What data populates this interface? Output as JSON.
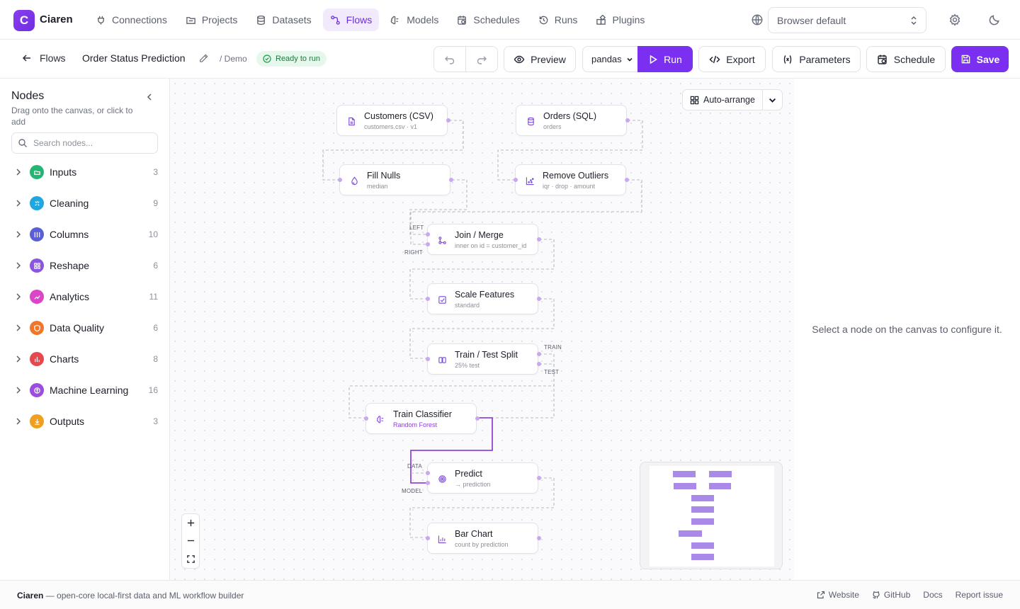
{
  "app": {
    "logo_letter": "C",
    "name": "Ciaren"
  },
  "nav": [
    {
      "label": "Connections",
      "icon": "plug-icon"
    },
    {
      "label": "Projects",
      "icon": "folder-icon"
    },
    {
      "label": "Datasets",
      "icon": "database-icon"
    },
    {
      "label": "Flows",
      "icon": "flow-icon",
      "active": true
    },
    {
      "label": "Models",
      "icon": "brain-icon"
    },
    {
      "label": "Schedules",
      "icon": "calendar-clock-icon"
    },
    {
      "label": "Runs",
      "icon": "history-icon"
    },
    {
      "label": "Plugins",
      "icon": "puzzle-icon"
    }
  ],
  "language_select": {
    "value": "Browser default"
  },
  "toolbar": {
    "back_label": "Flows",
    "flow_title": "Order Status Prediction",
    "breadcrumb": "/ Demo",
    "status": "Ready to run",
    "preview_label": "Preview",
    "engine": "pandas",
    "run_label": "Run",
    "export_label": "Export",
    "parameters_label": "Parameters",
    "schedule_label": "Schedule",
    "save_label": "Save"
  },
  "sidebar": {
    "title": "Nodes",
    "subtitle": "Drag onto the canvas, or click to add",
    "search_placeholder": "Search nodes...",
    "categories": [
      {
        "label": "Inputs",
        "count": "3",
        "color": "#22b573"
      },
      {
        "label": "Cleaning",
        "count": "9",
        "color": "#1ea7e1"
      },
      {
        "label": "Columns",
        "count": "10",
        "color": "#5b5fd6"
      },
      {
        "label": "Reshape",
        "count": "6",
        "color": "#8a55e0"
      },
      {
        "label": "Analytics",
        "count": "11",
        "color": "#d946c8"
      },
      {
        "label": "Data Quality",
        "count": "6",
        "color": "#f0762b"
      },
      {
        "label": "Charts",
        "count": "8",
        "color": "#e5484d"
      },
      {
        "label": "Machine Learning",
        "count": "16",
        "color": "#9b4de0"
      },
      {
        "label": "Outputs",
        "count": "3",
        "color": "#f0a020"
      }
    ]
  },
  "canvas": {
    "auto_arrange_label": "Auto-arrange",
    "nodes": [
      {
        "title": "Customers (CSV)",
        "sub": "customers.csv · v1",
        "icon": "file-icon"
      },
      {
        "title": "Orders (SQL)",
        "sub": "orders",
        "icon": "database-icon"
      },
      {
        "title": "Fill Nulls",
        "sub": "median",
        "icon": "droplet-icon"
      },
      {
        "title": "Remove Outliers",
        "sub": "iqr · drop · amount",
        "icon": "scatter-icon"
      },
      {
        "title": "Join / Merge",
        "sub": "inner on id = customer_id",
        "icon": "merge-icon"
      },
      {
        "title": "Scale Features",
        "sub": "standard",
        "icon": "scale-icon"
      },
      {
        "title": "Train / Test Split",
        "sub": "25% test",
        "icon": "split-icon"
      },
      {
        "title": "Train Classifier",
        "sub": "Random Forest",
        "icon": "brain-icon"
      },
      {
        "title": "Predict",
        "sub": "→ prediction",
        "icon": "target-icon"
      },
      {
        "title": "Bar Chart",
        "sub": "count by prediction",
        "icon": "bar-chart-icon"
      }
    ],
    "port_labels": {
      "left": "LEFT",
      "right": "RIGHT",
      "train": "TRAIN",
      "test": "TEST",
      "data": "DATA",
      "model": "MODEL"
    }
  },
  "inspector": {
    "empty_message": "Select a node on the canvas to configure it."
  },
  "footer": {
    "brand": "Ciaren",
    "tagline": "— open-core local-first data and ML workflow builder",
    "links": [
      "Website",
      "GitHub",
      "Docs",
      "Report issue"
    ]
  }
}
